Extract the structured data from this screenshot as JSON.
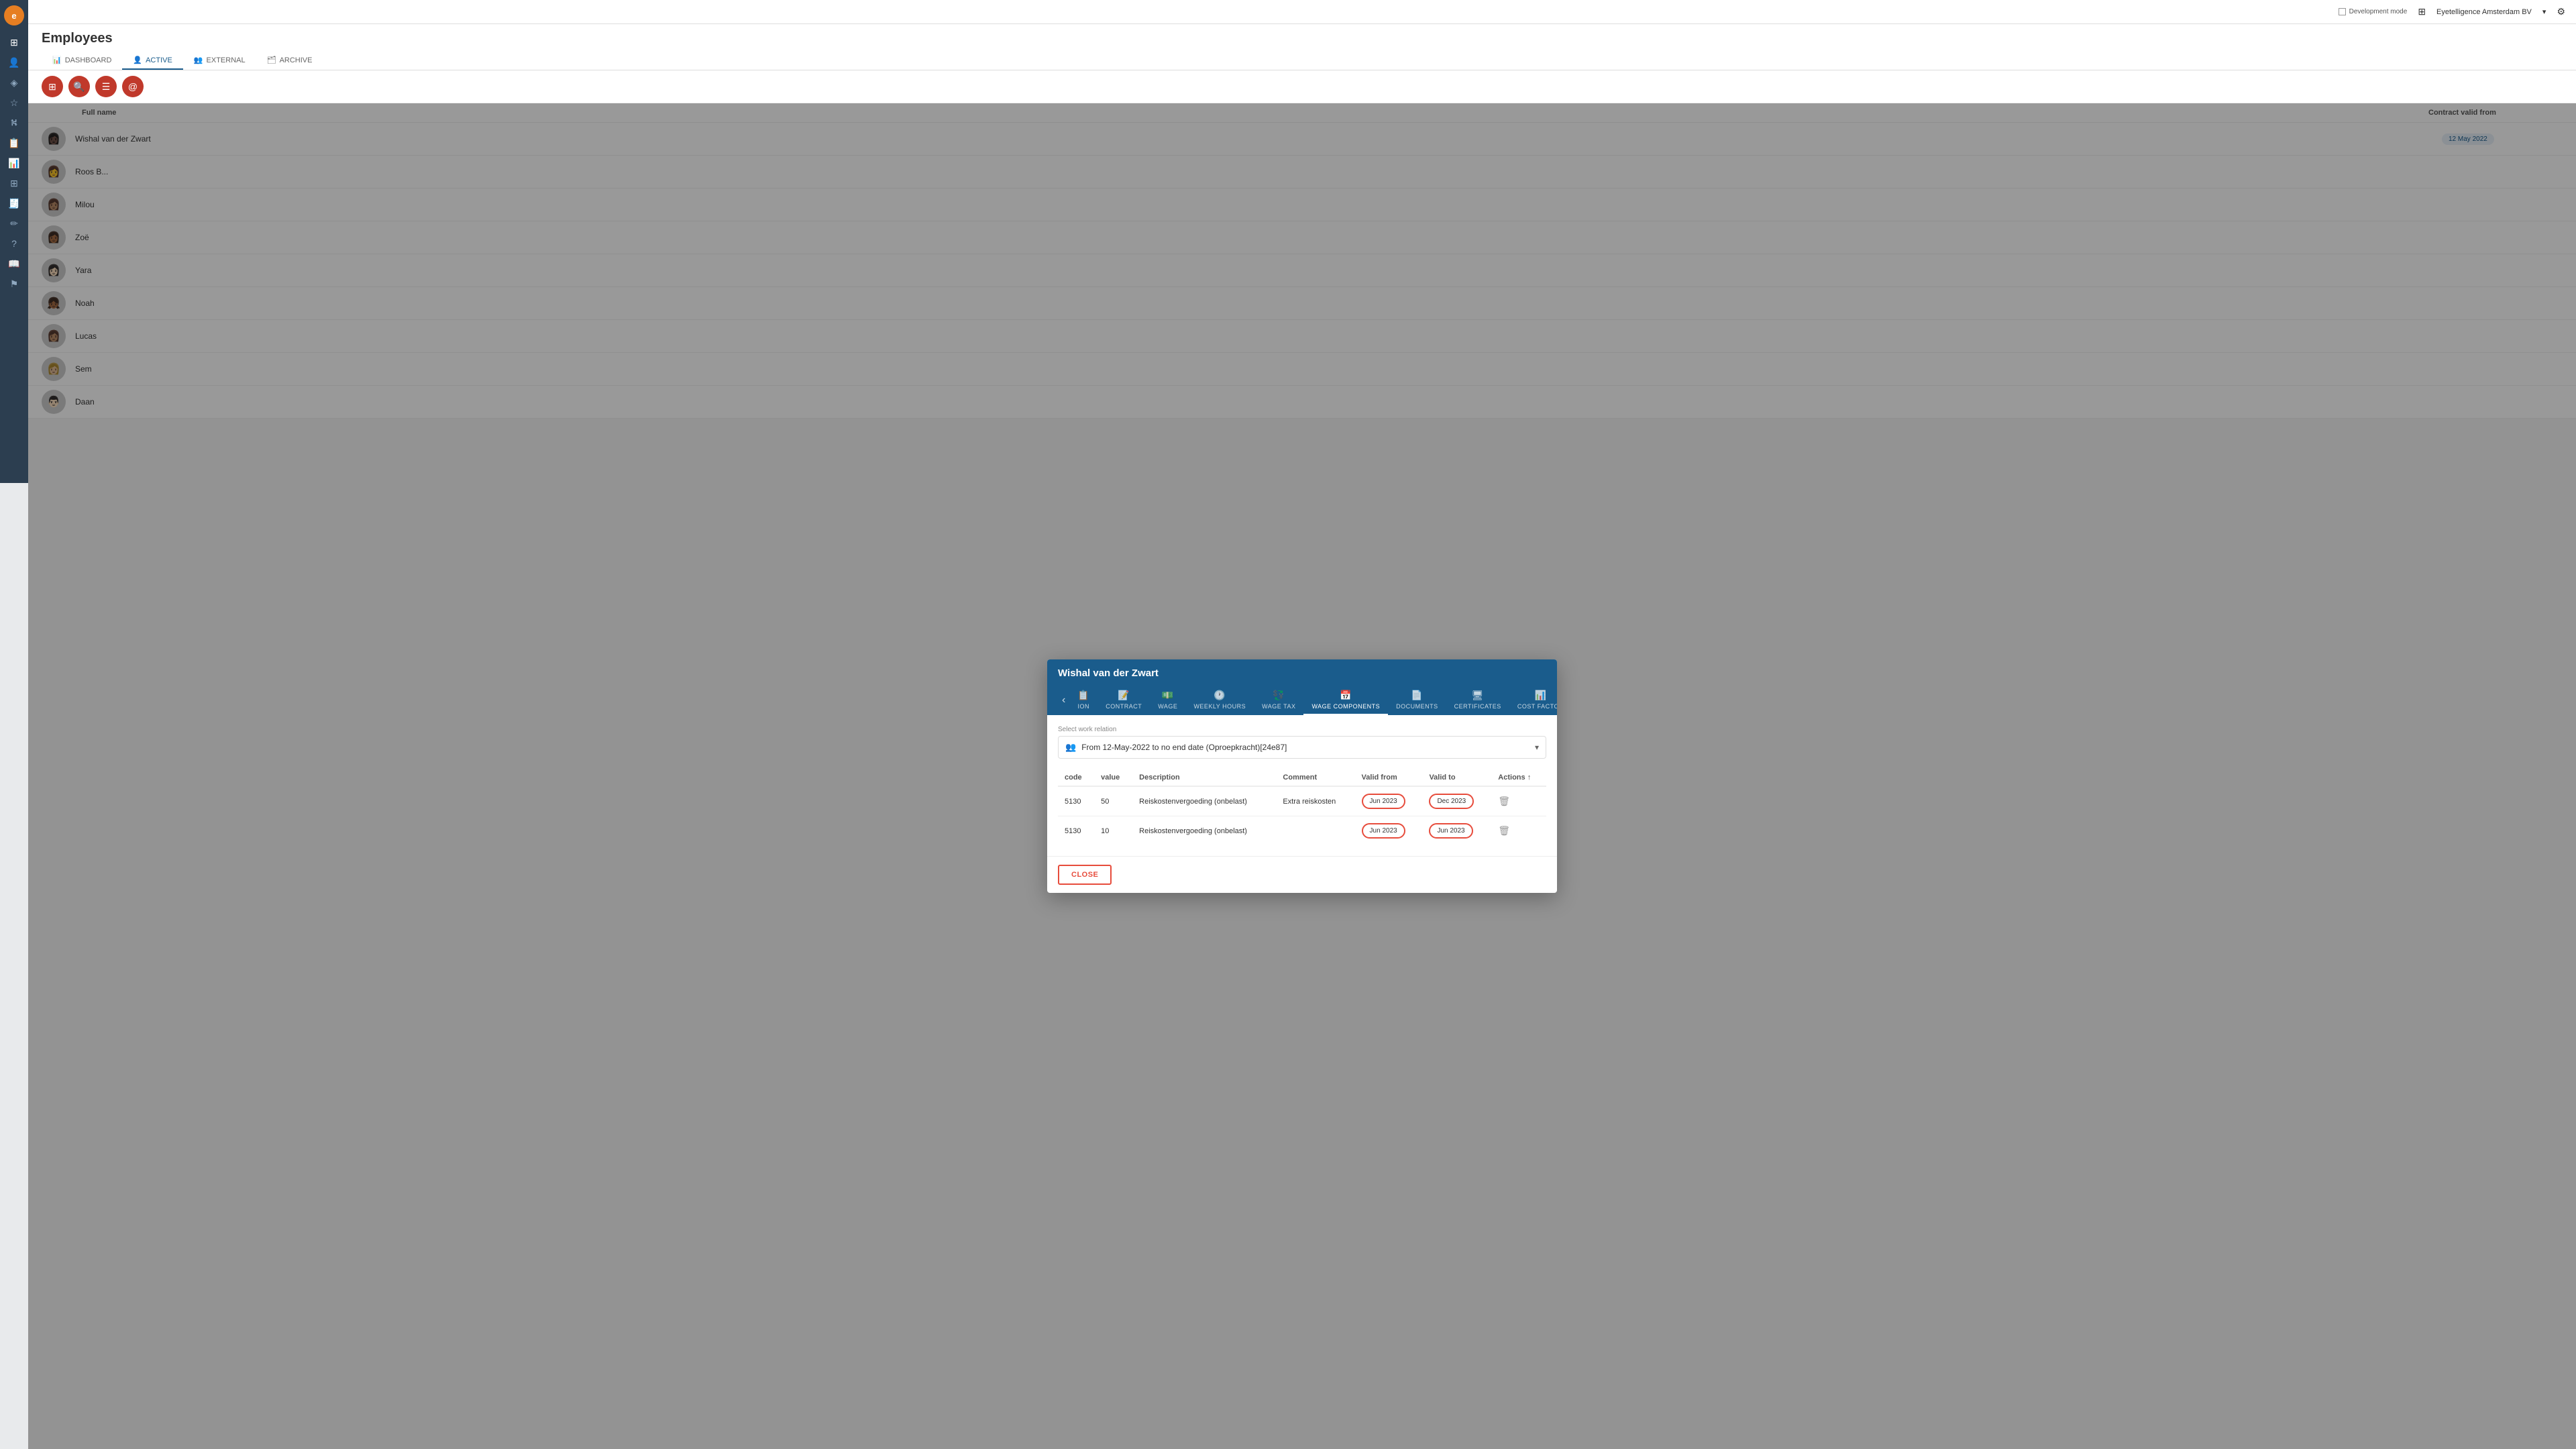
{
  "app": {
    "logo": "e",
    "company": "Eyetelligence Amsterdam BV",
    "dev_mode_label": "Development mode",
    "topbar_icons": [
      "grid-icon",
      "chevron-down-icon",
      "gear-icon"
    ]
  },
  "page": {
    "title": "Employees",
    "nav_tabs": [
      {
        "id": "dashboard",
        "label": "DASHBOARD",
        "icon": "📊",
        "active": false
      },
      {
        "id": "active",
        "label": "ACTIVE",
        "icon": "👤",
        "active": true
      },
      {
        "id": "external",
        "label": "EXTERNAL",
        "icon": "👥",
        "active": false
      },
      {
        "id": "archive",
        "label": "ARCHIVE",
        "icon": "🗂",
        "active": false
      }
    ]
  },
  "toolbar": {
    "buttons": [
      "kanban-icon",
      "search-icon",
      "list-icon",
      "email-icon"
    ]
  },
  "list": {
    "columns": [
      {
        "id": "full_name",
        "label": "Full name"
      },
      {
        "id": "contract_valid_from",
        "label": "Contract valid from"
      }
    ],
    "employees": [
      {
        "id": 1,
        "name": "Wishal van der Zwart",
        "avatar": "av1",
        "contract": "12 May 2022"
      },
      {
        "id": 2,
        "name": "Roos B...",
        "avatar": "av2",
        "contract": ""
      },
      {
        "id": 3,
        "name": "Milou",
        "avatar": "av3",
        "contract": ""
      },
      {
        "id": 4,
        "name": "Zoë",
        "avatar": "av4",
        "contract": ""
      },
      {
        "id": 5,
        "name": "Yara",
        "avatar": "av5",
        "contract": ""
      },
      {
        "id": 6,
        "name": "Noah",
        "avatar": "av6",
        "contract": ""
      },
      {
        "id": 7,
        "name": "Lucas",
        "avatar": "av7",
        "contract": ""
      },
      {
        "id": 8,
        "name": "Sem",
        "avatar": "av8",
        "contract": ""
      },
      {
        "id": 9,
        "name": "Daan",
        "avatar": "av9",
        "contract": ""
      }
    ]
  },
  "modal": {
    "title": "Wishal van der Zwart",
    "tabs": [
      {
        "id": "information",
        "label": "ION",
        "icon": "📋",
        "active": false
      },
      {
        "id": "contract",
        "label": "CONTRACT",
        "icon": "📝",
        "active": false
      },
      {
        "id": "wage",
        "label": "WAGE",
        "icon": "💵",
        "active": false
      },
      {
        "id": "weekly_hours",
        "label": "WEEKLY HOURS",
        "icon": "🕐",
        "active": false
      },
      {
        "id": "wage_tax",
        "label": "WAGE TAX",
        "icon": "💱",
        "active": false
      },
      {
        "id": "wage_components",
        "label": "WAGE COMPONENTS",
        "icon": "📅",
        "active": true
      },
      {
        "id": "documents",
        "label": "DOCUMENTS",
        "icon": "📄",
        "active": false
      },
      {
        "id": "certificates",
        "label": "CERTIFICATES",
        "icon": "🖥",
        "active": false
      },
      {
        "id": "cost_factor",
        "label": "COST FACTOR",
        "icon": "📊",
        "active": false
      }
    ],
    "select_label": "Select work relation",
    "select_value": "From 12-May-2022 to no end date (Oproepkracht)[24e87]",
    "table": {
      "columns": [
        {
          "id": "code",
          "label": "code"
        },
        {
          "id": "value",
          "label": "value"
        },
        {
          "id": "description",
          "label": "Description"
        },
        {
          "id": "comment",
          "label": "Comment"
        },
        {
          "id": "valid_from",
          "label": "Valid from"
        },
        {
          "id": "valid_to",
          "label": "Valid to"
        },
        {
          "id": "actions",
          "label": "Actions ↑"
        }
      ],
      "rows": [
        {
          "code": "5130",
          "value": "50",
          "description": "Reiskostenvergoeding (onbelast)",
          "comment": "Extra reiskosten",
          "valid_from": "Jun 2023",
          "valid_to": "Dec 2023"
        },
        {
          "code": "5130",
          "value": "10",
          "description": "Reiskostenvergoeding (onbelast)",
          "comment": "",
          "valid_from": "Jun 2023",
          "valid_to": "Jun 2023"
        }
      ]
    },
    "close_label": "CLOSE"
  },
  "sidebar": {
    "items": [
      {
        "id": "home",
        "icon": "⊞",
        "label": "home"
      },
      {
        "id": "person",
        "icon": "👤",
        "label": "person"
      },
      {
        "id": "dashboard",
        "icon": "⬡",
        "label": "dashboard"
      },
      {
        "id": "star",
        "icon": "☆",
        "label": "star"
      },
      {
        "id": "tree",
        "icon": "⛕",
        "label": "tree"
      },
      {
        "id": "reports",
        "icon": "📋",
        "label": "reports"
      },
      {
        "id": "chart",
        "icon": "📊",
        "label": "chart"
      },
      {
        "id": "grid",
        "icon": "⊞",
        "label": "grid"
      },
      {
        "id": "receipt",
        "icon": "🧾",
        "label": "receipt"
      },
      {
        "id": "edit",
        "icon": "✏",
        "label": "edit"
      },
      {
        "id": "question",
        "icon": "?",
        "label": "question"
      },
      {
        "id": "book",
        "icon": "📖",
        "label": "book"
      },
      {
        "id": "flag",
        "icon": "⚑",
        "label": "flag"
      }
    ]
  }
}
